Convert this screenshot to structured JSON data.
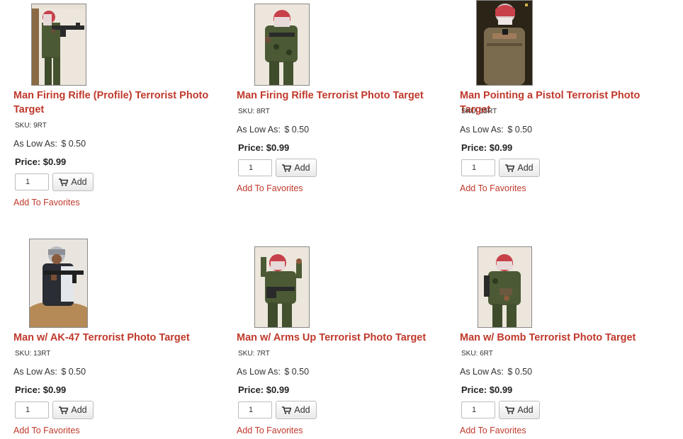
{
  "products": [
    {
      "title": "Man Firing Rifle (Profile) Terrorist Photo Target",
      "sku": "SKU: 9RT",
      "as_low_as_label": "As Low As:",
      "as_low_as_value": "$ 0.50",
      "price": "Price: $0.99",
      "qty": "1",
      "add_label": "Add",
      "favorites_label": "Add To Favorites",
      "image_icon": "rifle-profile-target-photo"
    },
    {
      "title": "Man Firing Rifle Terrorist Photo Target",
      "sku": "SKU: 8RT",
      "as_low_as_label": "As Low As:",
      "as_low_as_value": "$ 0.50",
      "price": "Price: $0.99",
      "qty": "1",
      "add_label": "Add",
      "favorites_label": "Add To Favorites",
      "image_icon": "rifle-front-target-photo"
    },
    {
      "title": "Man Pointing a Pistol Terrorist Photo Target",
      "sku": "SKU: 15RT",
      "as_low_as_label": "As Low As:",
      "as_low_as_value": "$ 0.50",
      "price": "Price: $0.99",
      "qty": "1",
      "add_label": "Add",
      "favorites_label": "Add To Favorites",
      "image_icon": "pistol-target-photo"
    },
    {
      "title": "Man w/ AK-47 Terrorist Photo Target",
      "sku": "SKU: 13RT",
      "as_low_as_label": "As Low As:",
      "as_low_as_value": "$ 0.50",
      "price": "Price: $0.99",
      "qty": "1",
      "add_label": "Add",
      "favorites_label": "Add To Favorites",
      "image_icon": "ak47-target-photo"
    },
    {
      "title": "Man w/ Arms Up Terrorist Photo Target",
      "sku": "SKU: 7RT",
      "as_low_as_label": "As Low As:",
      "as_low_as_value": "$ 0.50",
      "price": "Price: $0.99",
      "qty": "1",
      "add_label": "Add",
      "favorites_label": "Add To Favorites",
      "image_icon": "arms-up-target-photo"
    },
    {
      "title": "Man w/ Bomb Terrorist Photo Target",
      "sku": "SKU: 6RT",
      "as_low_as_label": "As Low As:",
      "as_low_as_value": "$ 0.50",
      "price": "Price: $0.99",
      "qty": "1",
      "add_label": "Add",
      "favorites_label": "Add To Favorites",
      "image_icon": "bomb-target-photo"
    }
  ],
  "colors": {
    "link": "#c0392b",
    "text": "#333333",
    "keffiyeh": "#c8404a",
    "camo": "#4b5a34"
  },
  "icons": {
    "add_button": "cart-icon"
  }
}
